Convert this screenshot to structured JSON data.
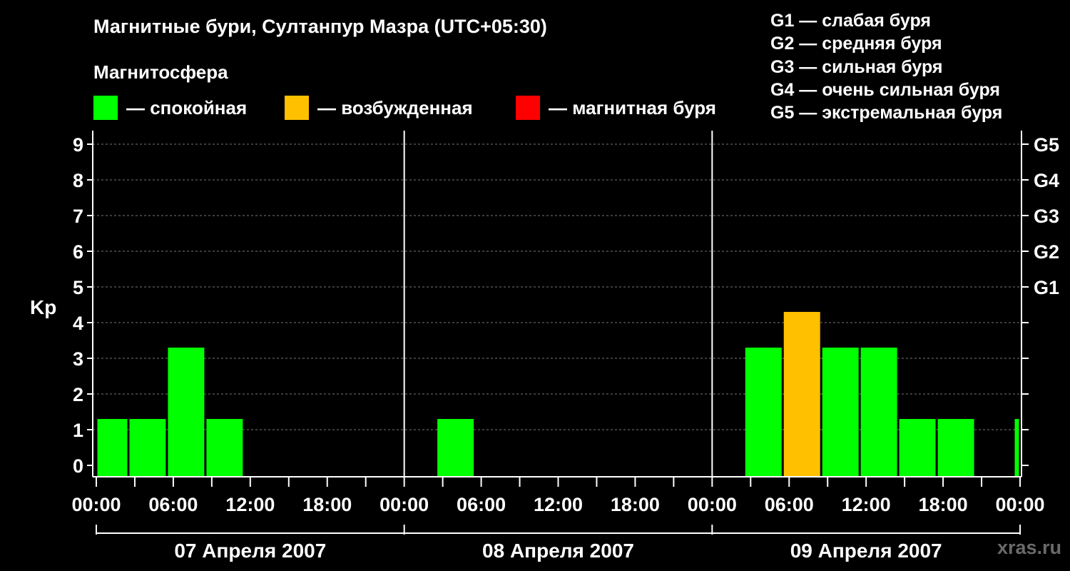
{
  "title": "Магнитные бури, Султанпур Мазра (UTC+05:30)",
  "magnetosphere_label": "Магнитосфера",
  "legend": [
    {
      "color": "#00ff00",
      "label": "— спокойная"
    },
    {
      "color": "#ffc000",
      "label": "— возбужденная"
    },
    {
      "color": "#ff0000",
      "label": "— магнитная буря"
    }
  ],
  "g_scale": [
    "G1 — слабая буря",
    "G2 — средняя буря",
    "G3 — сильная буря",
    "G4 — очень сильная буря",
    "G5 — экстремальная буря"
  ],
  "watermark": "xras.ru",
  "chart_data": {
    "type": "bar",
    "ylabel": "Kp",
    "ylim": [
      0,
      9
    ],
    "y_ticks": [
      "0",
      "1",
      "2",
      "3",
      "4",
      "5",
      "6",
      "7",
      "8",
      "9"
    ],
    "right_ticks": [
      {
        "value": 5,
        "label": "G1"
      },
      {
        "value": 6,
        "label": "G2"
      },
      {
        "value": 7,
        "label": "G3"
      },
      {
        "value": 8,
        "label": "G4"
      },
      {
        "value": 9,
        "label": "G5"
      }
    ],
    "x_tick_labels": [
      "00:00",
      "06:00",
      "12:00",
      "18:00",
      "00:00",
      "06:00",
      "12:00",
      "18:00",
      "00:00",
      "06:00",
      "12:00",
      "18:00",
      "00:00"
    ],
    "days": [
      "07 Апреля 2007",
      "08 Апреля 2007",
      "09 Апреля 2007"
    ],
    "grid": true,
    "bars": [
      {
        "start": "2007-04-07 00:00",
        "end": "2007-04-07 02:30",
        "kp": 1,
        "level": "calm"
      },
      {
        "start": "2007-04-07 02:30",
        "end": "2007-04-07 05:30",
        "kp": 1,
        "level": "calm"
      },
      {
        "start": "2007-04-07 05:30",
        "end": "2007-04-07 08:30",
        "kp": 3,
        "level": "calm"
      },
      {
        "start": "2007-04-07 08:30",
        "end": "2007-04-07 11:30",
        "kp": 1,
        "level": "calm"
      },
      {
        "start": "2007-04-08 02:30",
        "end": "2007-04-08 05:30",
        "kp": 1,
        "level": "calm"
      },
      {
        "start": "2007-04-09 02:30",
        "end": "2007-04-09 05:30",
        "kp": 3,
        "level": "calm"
      },
      {
        "start": "2007-04-09 05:30",
        "end": "2007-04-09 08:30",
        "kp": 4,
        "level": "active"
      },
      {
        "start": "2007-04-09 08:30",
        "end": "2007-04-09 11:30",
        "kp": 3,
        "level": "calm"
      },
      {
        "start": "2007-04-09 11:30",
        "end": "2007-04-09 14:30",
        "kp": 3,
        "level": "calm"
      },
      {
        "start": "2007-04-09 14:30",
        "end": "2007-04-09 17:30",
        "kp": 1,
        "level": "calm"
      },
      {
        "start": "2007-04-09 17:30",
        "end": "2007-04-09 20:30",
        "kp": 1,
        "level": "calm"
      },
      {
        "start": "2007-04-09 23:30",
        "end": "2007-04-10 00:00",
        "kp": 1,
        "level": "calm"
      }
    ],
    "level_colors": {
      "calm": "#00ff00",
      "active": "#ffc000",
      "storm": "#ff0000"
    }
  }
}
